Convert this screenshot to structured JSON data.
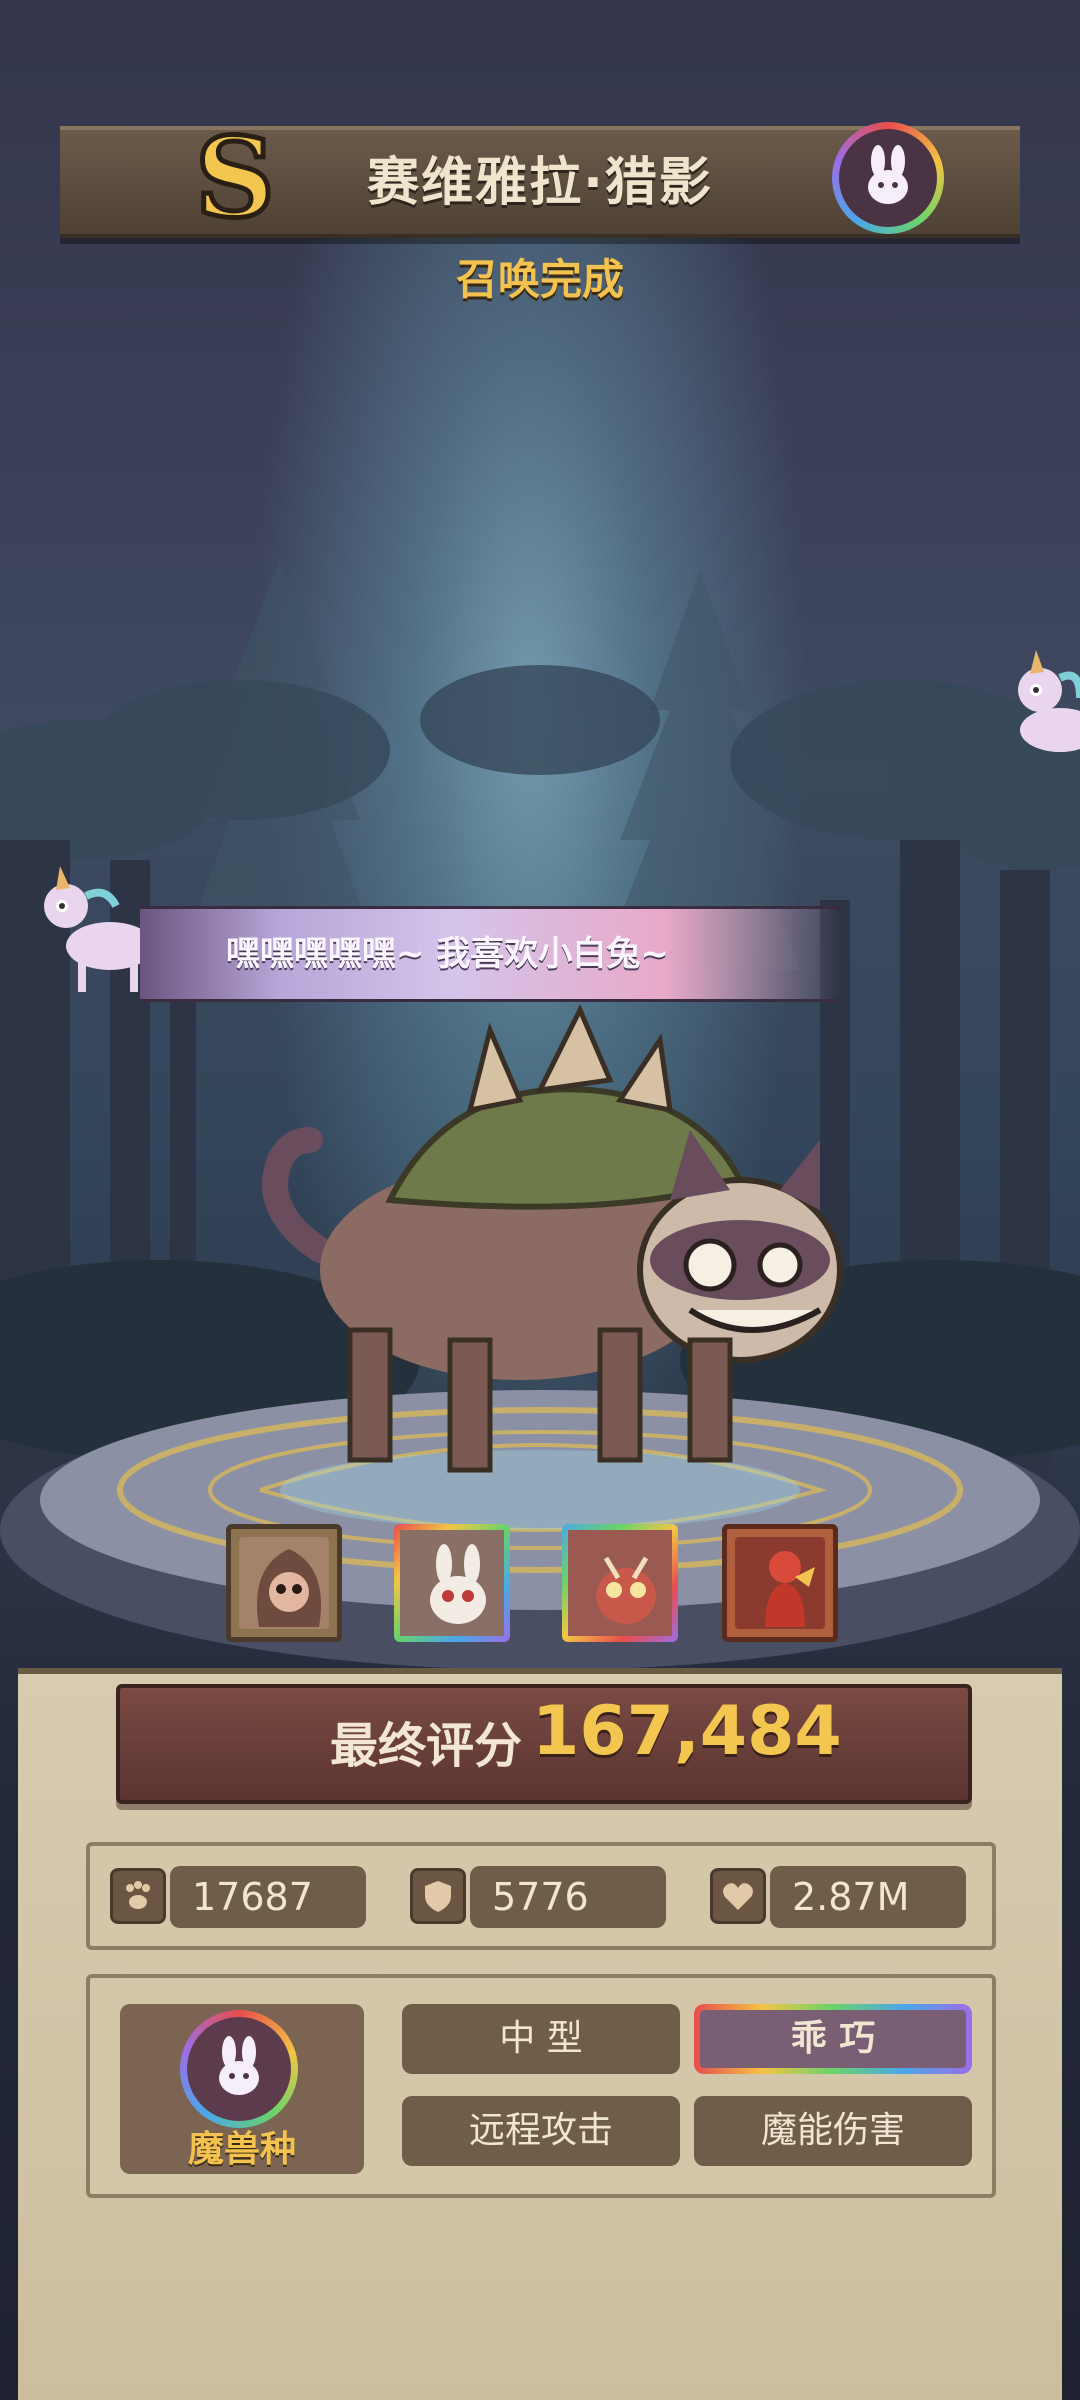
{
  "header": {
    "rank_letter": "S",
    "title": "赛维雅拉·猎影",
    "subtitle": "召唤完成"
  },
  "dialog": {
    "text": "嘿嘿嘿嘿嘿~ 我喜欢小白兔~"
  },
  "skills": [
    {
      "name": "skill-1",
      "frame": "#8d7350",
      "face": "#a5826a"
    },
    {
      "name": "skill-2",
      "frame": "rainbow",
      "face": "#8a6f66"
    },
    {
      "name": "skill-3",
      "frame": "rainbow",
      "face": "#9a5a52"
    },
    {
      "name": "skill-4",
      "frame": "#b0603f",
      "face": "#8a3b2e"
    }
  ],
  "score": {
    "label": "最终评分",
    "value": "167,484"
  },
  "stats": [
    {
      "icon": "paw-icon",
      "value": "17687"
    },
    {
      "icon": "shield-icon",
      "value": "5776"
    },
    {
      "icon": "heart-icon",
      "value": "2.87M"
    }
  ],
  "info": {
    "type_label": "魔兽种",
    "tags": [
      "中 型",
      "乖 巧",
      "远程攻击",
      "魔能伤害"
    ]
  },
  "colors": {
    "accent_gold": "#f3c24f",
    "panel": "#cfc1a3",
    "tag_bg": "#6f5c49"
  }
}
